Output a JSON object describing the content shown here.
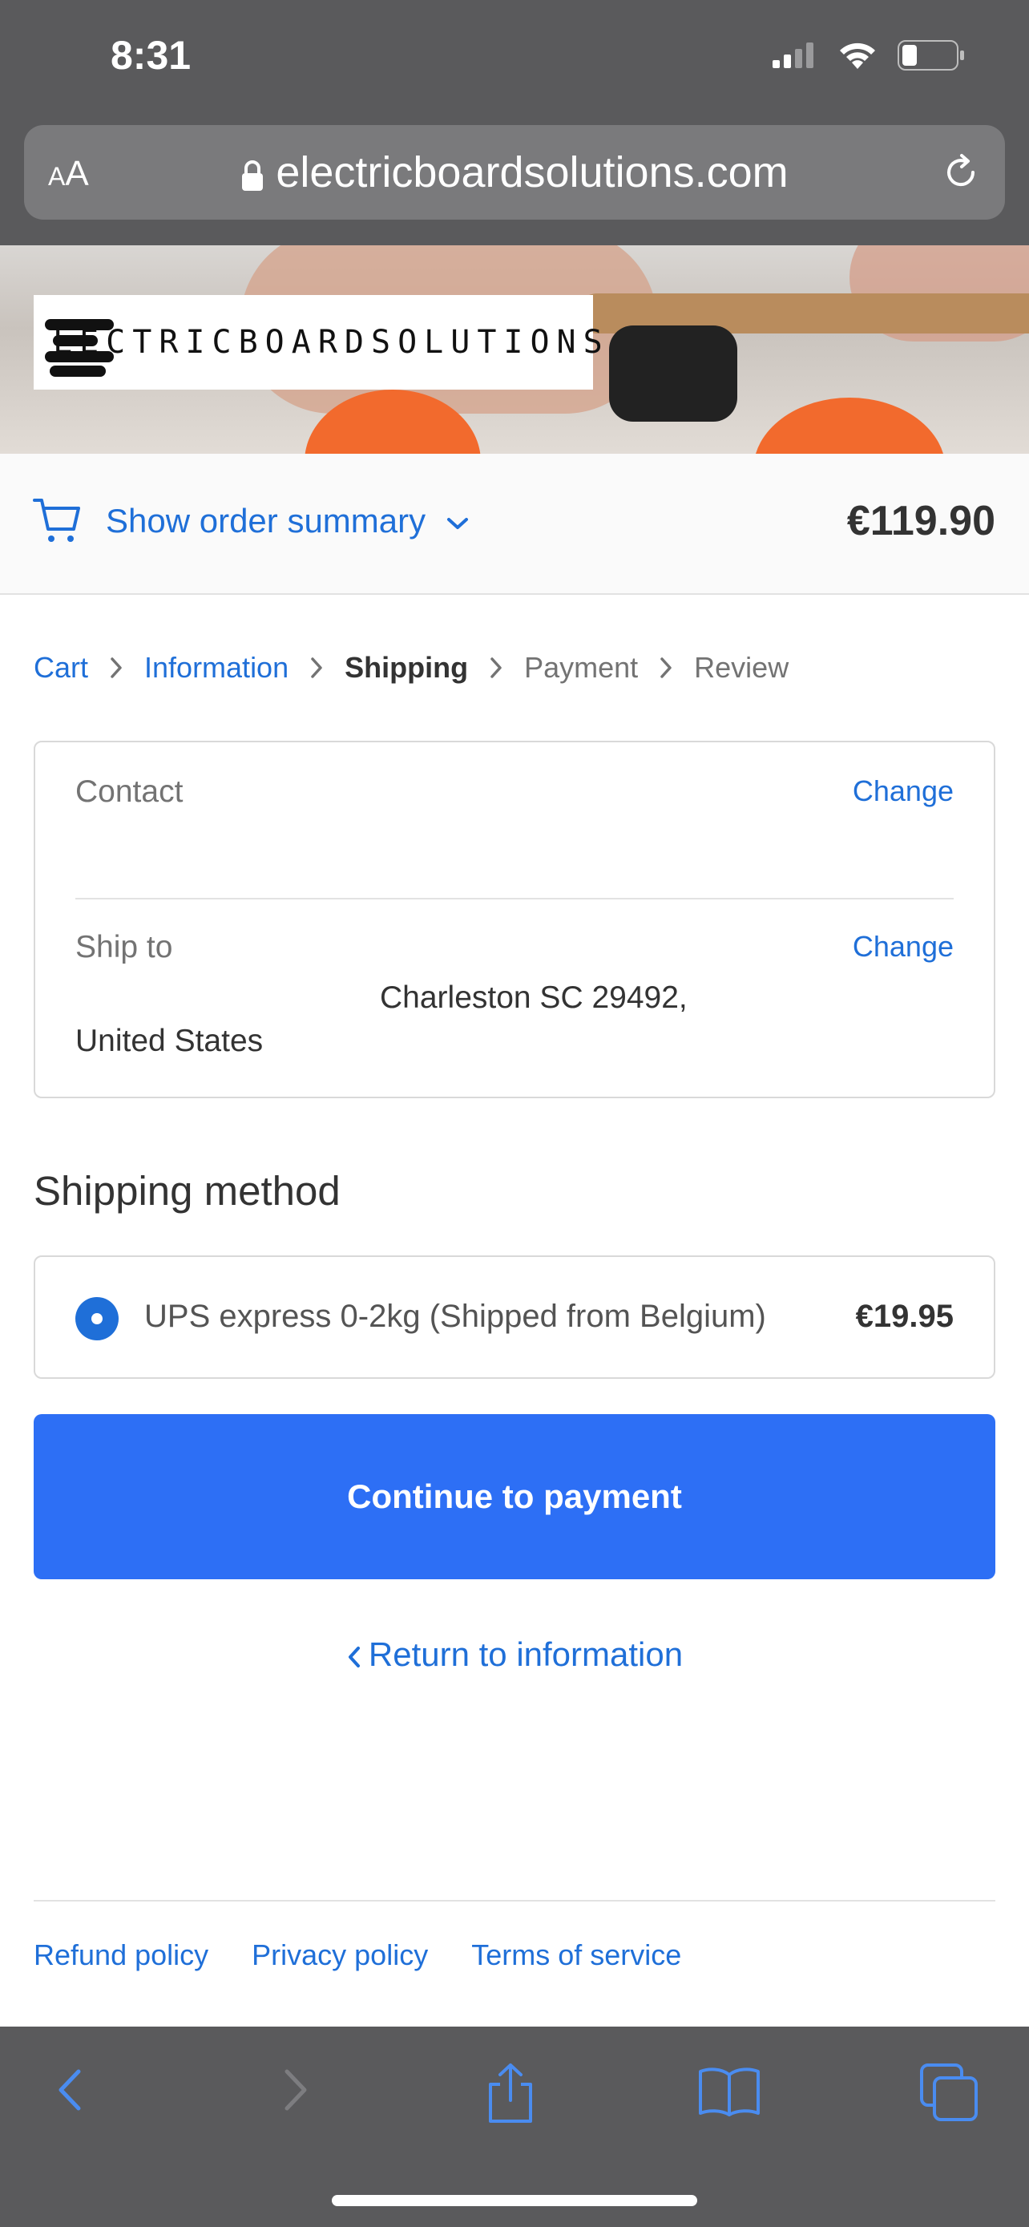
{
  "status_bar": {
    "time": "8:31"
  },
  "browser": {
    "text_size_label_small": "A",
    "text_size_label_large": "A",
    "url": "electricboardsolutions.com"
  },
  "brand": {
    "logo_text": "LECTRICBOARDSOLUTIONS"
  },
  "order_summary": {
    "toggle_label": "Show order summary",
    "total": "€119.90"
  },
  "breadcrumb": {
    "items": [
      {
        "label": "Cart",
        "state": "link"
      },
      {
        "label": "Information",
        "state": "link"
      },
      {
        "label": "Shipping",
        "state": "current"
      },
      {
        "label": "Payment",
        "state": "upcoming"
      },
      {
        "label": "Review",
        "state": "upcoming"
      }
    ]
  },
  "review": {
    "contact": {
      "label": "Contact",
      "change_label": "Change"
    },
    "ship_to": {
      "label": "Ship to",
      "change_label": "Change",
      "address_line1": "Charleston SC 29492,",
      "address_line2": "United States"
    }
  },
  "shipping_method": {
    "title": "Shipping method",
    "option": {
      "label": "UPS express 0-2kg (Shipped from Belgium)",
      "price": "€19.95",
      "selected": true
    }
  },
  "actions": {
    "continue_label": "Continue to payment",
    "return_label": "Return to information"
  },
  "footer": {
    "links": [
      "Refund policy",
      "Privacy policy",
      "Terms of service"
    ]
  },
  "colors": {
    "accent": "#1f6fd8",
    "button": "#2d6ff5",
    "chrome": "#5a5a5c"
  }
}
